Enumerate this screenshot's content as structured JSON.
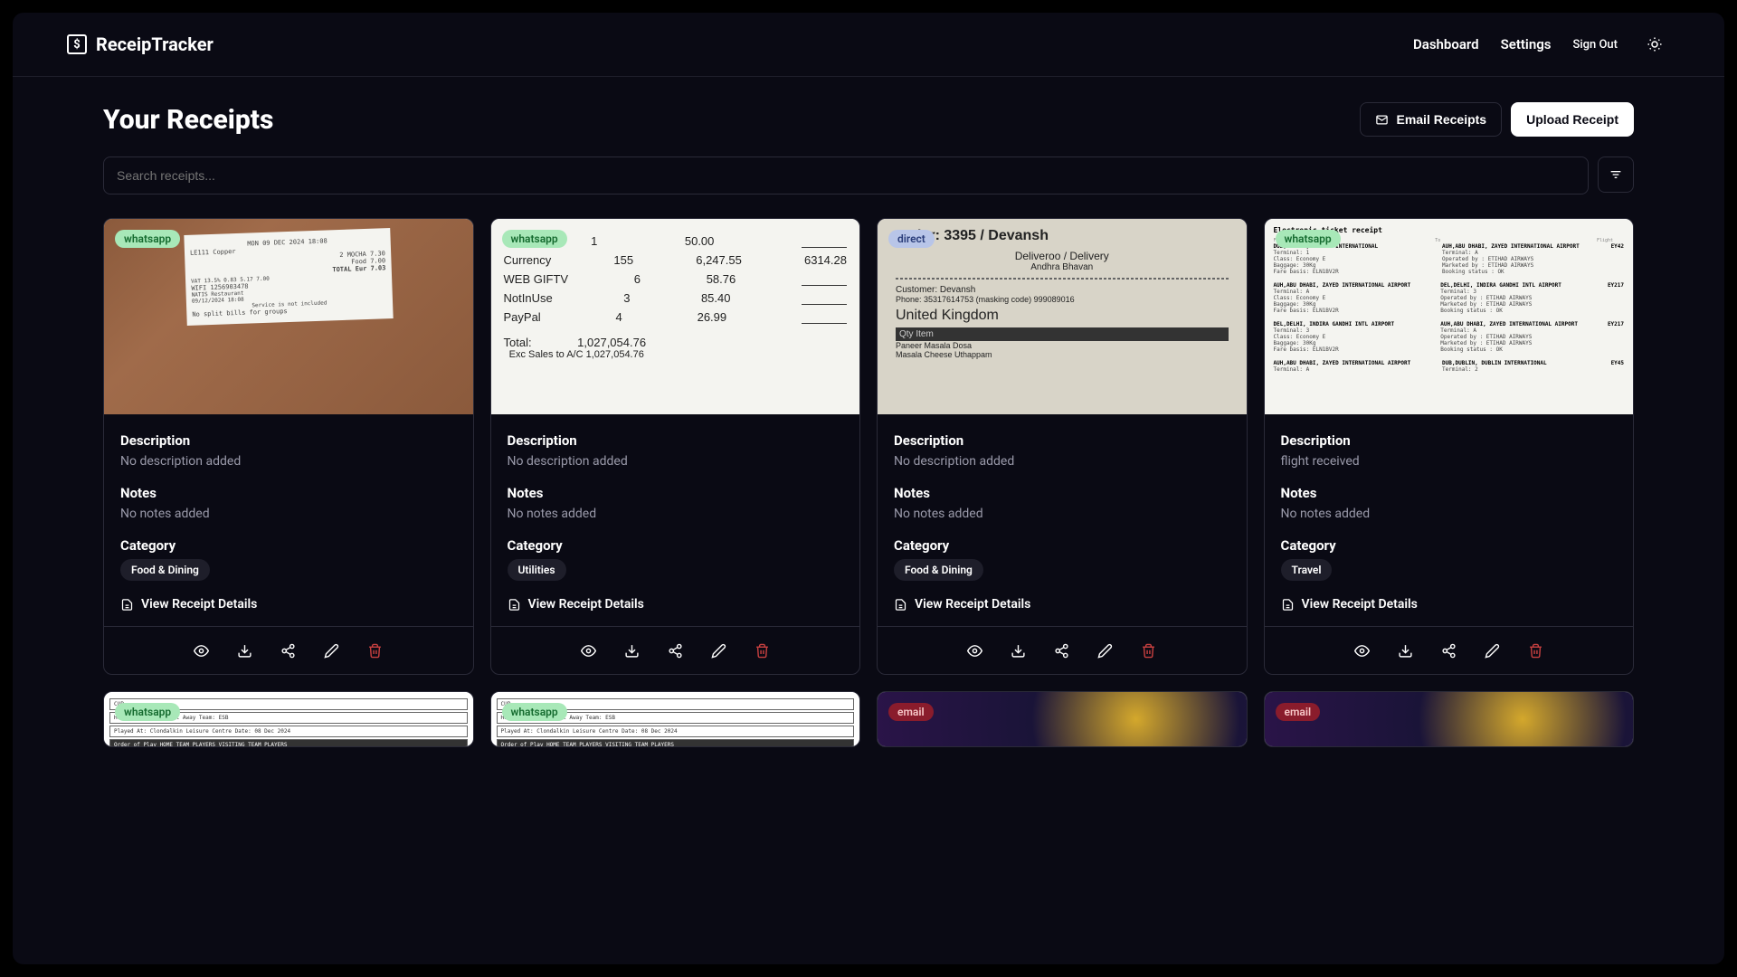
{
  "brand": {
    "name": "ReceipTracker",
    "logo_symbol": "$"
  },
  "nav": {
    "dashboard": "Dashboard",
    "settings": "Settings",
    "sign_out": "Sign Out"
  },
  "page": {
    "title": "Your Receipts",
    "actions": {
      "email_receipts": "Email Receipts",
      "upload_receipt": "Upload Receipt"
    },
    "search_placeholder": "Search receipts..."
  },
  "labels": {
    "description": "Description",
    "notes": "Notes",
    "category": "Category",
    "view_details": "View Receipt Details",
    "no_description": "No description added",
    "no_notes": "No notes added"
  },
  "badges": {
    "whatsapp": "whatsapp",
    "direct": "direct",
    "email": "email"
  },
  "categories": {
    "food_dining": "Food & Dining",
    "utilities": "Utilities",
    "travel": "Travel"
  },
  "receipts": [
    {
      "source": "whatsapp",
      "description": "No description added",
      "notes": "No notes added",
      "category": "Food & Dining"
    },
    {
      "source": "whatsapp",
      "description": "No description added",
      "notes": "No notes added",
      "category": "Utilities"
    },
    {
      "source": "direct",
      "description": "No description added",
      "notes": "No notes added",
      "category": "Food & Dining"
    },
    {
      "source": "whatsapp",
      "description": "flight received",
      "notes": "No notes added",
      "category": "Travel"
    },
    {
      "source": "whatsapp"
    },
    {
      "source": "whatsapp"
    },
    {
      "source": "email"
    },
    {
      "source": "email"
    }
  ],
  "receipt_visuals": {
    "r0": {
      "header": "MON 09 DEC 2024   18:08",
      "lines": [
        "LE111    Copper",
        "2 MOCHA       7.30",
        "Food   7.00",
        "TOTAL Eur   7.03",
        "VAT 13.5%  0.83  5.17  7.00",
        "WIFI 1256903478",
        "NATIS  Restaurant",
        "09/12/2024   18:08",
        "Service is not included",
        "No split bills   for groups"
      ]
    },
    "r1": {
      "rows": [
        [
          "",
          "1",
          "50.00",
          ""
        ],
        [
          "Currency",
          "155",
          "6,247.55",
          "6314.28"
        ],
        [
          "WEB GIFTV",
          "6",
          "58.76",
          ""
        ],
        [
          "NotInUse",
          "3",
          "85.40",
          ""
        ],
        [
          "PayPal",
          "4",
          "26.99",
          ""
        ]
      ],
      "total_label": "Total:",
      "total_value": "1,027,054.76",
      "sub_label": "Exc Sales to A/C",
      "sub_value": "1,027,054.76"
    },
    "r2": {
      "lines": [
        "Order: 3395 / Devansh",
        "Deliveroo / Delivery",
        "Andhra Bhavan",
        "Customer: Devansh",
        "Phone: 35317614753 (masking code) 999089016",
        "United Kingdom",
        "Qty  Item",
        "Paneer Masala Dosa",
        "Masala Cheese Uthappam"
      ]
    },
    "r3": {
      "header": "Electronic ticket receipt",
      "segments": [
        {
          "from": "DUB,DUBLIN, DUBLIN INTERNATIONAL",
          "to": "AUH,ABU DHABI, ZAYED INTERNATIONAL AIRPORT",
          "flight": "EY42",
          "terminal_from": "Terminal: 1",
          "terminal_to": "Terminal: A",
          "class": "Class: Economy E",
          "operated": "Operated by : ETIHAD AIRWAYS",
          "marketed": "Marketed by : ETIHAD AIRWAYS",
          "baggage": "Baggage: 30Kg",
          "fare": "Fare basis: ELN1BV2R",
          "status": "Booking status : OK"
        },
        {
          "from": "AUH,ABU DHABI, ZAYED INTERNATIONAL AIRPORT",
          "to": "DEL,DELHI, INDIRA GANDHI INTL AIRPORT",
          "flight": "EY217",
          "terminal_from": "Terminal: A",
          "terminal_to": "Terminal: 3"
        },
        {
          "from": "DEL,DELHI, INDIRA GANDHI INTL AIRPORT",
          "to": "AUH,ABU DHABI, ZAYED INTERNATIONAL AIRPORT",
          "flight": "EY217",
          "terminal_from": "Terminal: 3",
          "terminal_to": "Terminal: A"
        },
        {
          "from": "AUH,ABU DHABI, ZAYED INTERNATIONAL AIRPORT",
          "to": "DUB,DUBLIN, DUBLIN INTERNATIONAL",
          "flight": "EY45",
          "terminal_from": "Terminal: A",
          "terminal_to": "Terminal: 2"
        }
      ]
    },
    "r4": {
      "lines": [
        "CUP",
        "Home Team: Liverpool  Away Team: ESB",
        "Played At: Clondalkin Leisure Centre  Date: 08 Dec 2024",
        "Order of Play   HOME TEAM PLAYERS   VISITING TEAM PLAYERS"
      ]
    }
  }
}
